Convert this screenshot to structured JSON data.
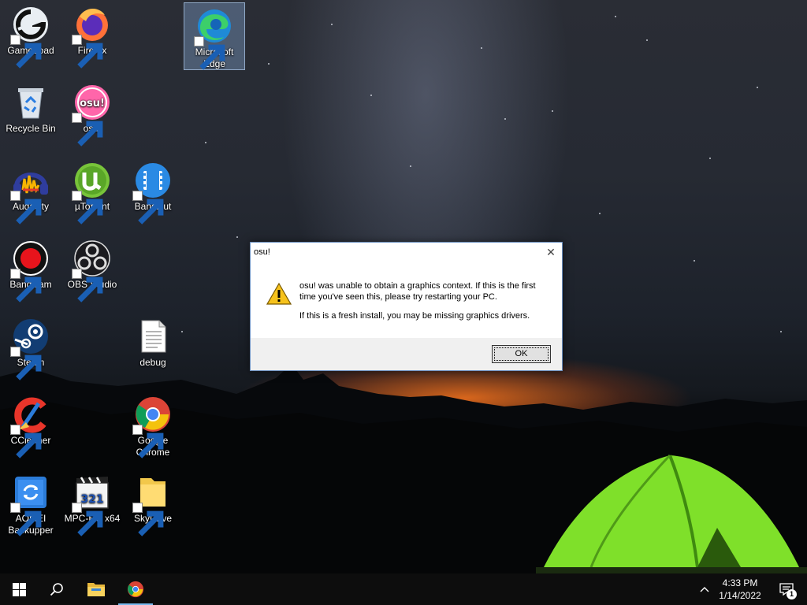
{
  "desktop_icons": [
    {
      "label": "GameLoad",
      "icon": "gameload-icon"
    },
    {
      "label": "Firefox",
      "icon": "firefox-icon"
    },
    {
      "label": "Microsoft Edge",
      "icon": "edge-icon",
      "selected": true
    },
    {
      "label": "Recycle Bin",
      "icon": "recycle-bin-icon"
    },
    {
      "label": "osu!",
      "icon": "osu-icon"
    },
    {
      "label": "Audacity",
      "icon": "audacity-icon"
    },
    {
      "label": "µTorrent",
      "icon": "utorrent-icon"
    },
    {
      "label": "Bandicut",
      "icon": "bandicut-icon"
    },
    {
      "label": "Bandicam",
      "icon": "bandicam-icon"
    },
    {
      "label": "OBS Studio",
      "icon": "obs-icon"
    },
    {
      "label": "Steam",
      "icon": "steam-icon"
    },
    {
      "label": "debug",
      "icon": "text-file-icon"
    },
    {
      "label": "CCleaner",
      "icon": "ccleaner-icon"
    },
    {
      "label": "Google Chrome",
      "icon": "chrome-icon"
    },
    {
      "label": "AOMEI Backupper",
      "icon": "aomei-icon"
    },
    {
      "label": "MPC-HC x64",
      "icon": "mpc-hc-icon"
    },
    {
      "label": "SkyDrive",
      "icon": "folder-icon"
    }
  ],
  "dialog": {
    "title": "osu!",
    "message_1": "osu! was unable to obtain a graphics context. If this is the first time you've seen this, please try restarting your PC.",
    "message_2": "If this is a fresh install, you may be missing graphics drivers.",
    "ok_label": "OK",
    "icon": "warning-icon"
  },
  "taskbar": {
    "buttons": [
      {
        "icon": "windows-start-icon"
      },
      {
        "icon": "search-icon"
      },
      {
        "icon": "file-explorer-icon"
      },
      {
        "icon": "chrome-icon",
        "active": true
      }
    ],
    "time": "4:33 PM",
    "date": "1/14/2022",
    "notification_count": "1"
  },
  "colors": {
    "dialog_border": "#6b8fbf",
    "taskbar_bg": "#0d0d0d",
    "active_indicator": "#76b9ed"
  }
}
